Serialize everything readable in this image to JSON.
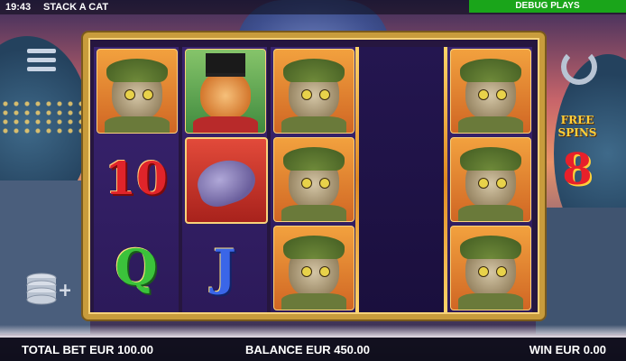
{
  "top_bar": {
    "time": "19:43",
    "title": "STACK A CAT",
    "debug_label": "DEBUG PLAYS"
  },
  "free_spins": {
    "label_line1": "FREE",
    "label_line2": "SPINS",
    "count": "8"
  },
  "reels": [
    [
      {
        "type": "detective-cat"
      },
      {
        "type": "ten",
        "label": "10"
      },
      {
        "type": "q",
        "label": "Q"
      }
    ],
    [
      {
        "type": "top-hat-cat"
      },
      {
        "type": "mouse"
      },
      {
        "type": "j",
        "label": "J"
      }
    ],
    [
      {
        "type": "detective-cat"
      },
      {
        "type": "detective-cat"
      },
      {
        "type": "detective-cat"
      }
    ],
    [
      {
        "type": "empty"
      },
      {
        "type": "empty"
      },
      {
        "type": "empty"
      }
    ],
    [
      {
        "type": "detective-cat"
      },
      {
        "type": "detective-cat"
      },
      {
        "type": "detective-cat"
      }
    ]
  ],
  "bottom_bar": {
    "total_bet": "TOTAL BET EUR 100.00",
    "balance": "BALANCE EUR 450.00",
    "win": "WIN EUR 0.00"
  },
  "icons": {
    "menu": "menu-icon",
    "stack": "coin-stack-icon",
    "spin": "spin-icon"
  }
}
